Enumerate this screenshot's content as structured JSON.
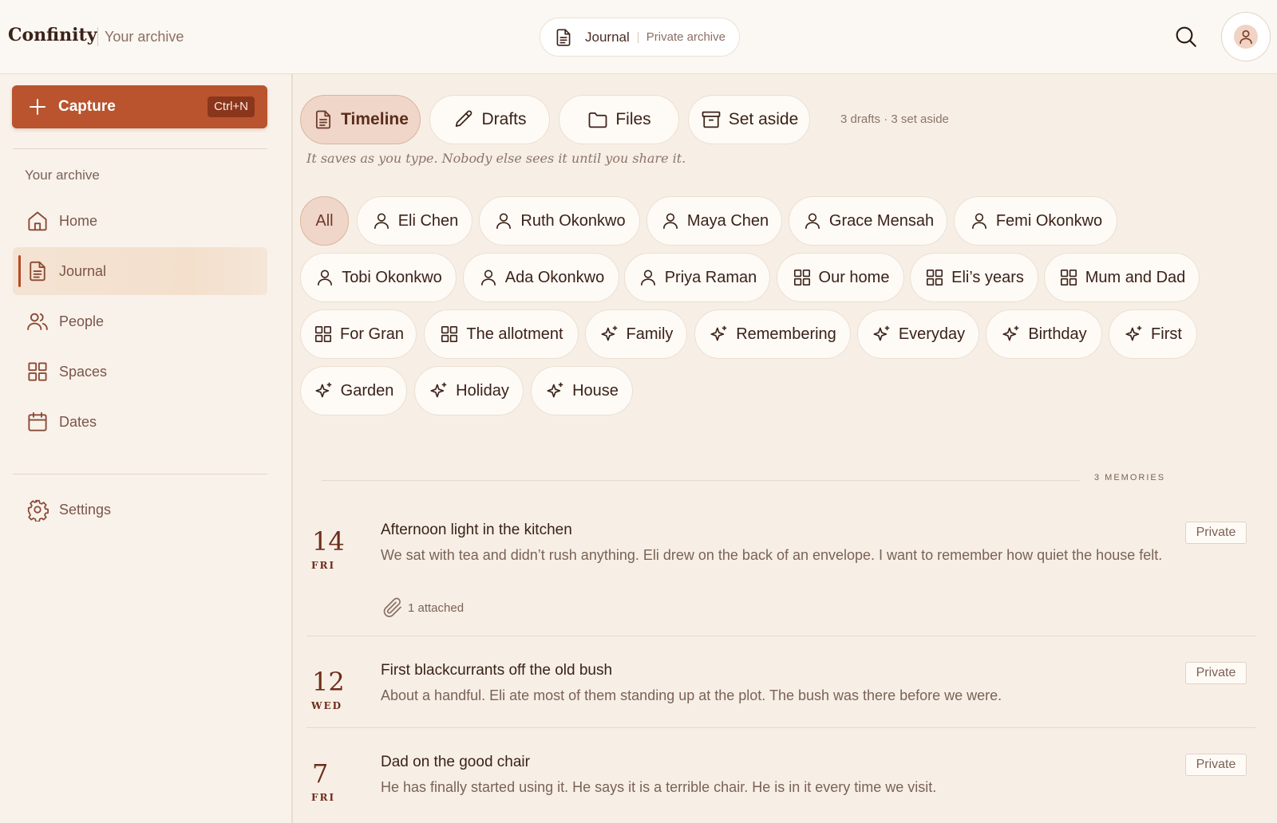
{
  "app": {
    "brand": "Confinity",
    "brand_sub": "Your archive"
  },
  "header": {
    "section_title": "Journal",
    "section_sub": "Private archive"
  },
  "sidebar": {
    "capture_label": "Capture",
    "capture_shortcut": "Ctrl+N",
    "section_label": "Your archive",
    "items": [
      {
        "label": "Home",
        "icon": "home-icon"
      },
      {
        "label": "Journal",
        "icon": "document-icon",
        "active": true
      },
      {
        "label": "People",
        "icon": "people-icon"
      },
      {
        "label": "Spaces",
        "icon": "grid-icon"
      },
      {
        "label": "Dates",
        "icon": "calendar-icon"
      }
    ],
    "settings_label": "Settings"
  },
  "tabs": [
    {
      "label": "Timeline",
      "icon": "document-icon",
      "active": true
    },
    {
      "label": "Drafts",
      "icon": "pencil-icon"
    },
    {
      "label": "Files",
      "icon": "folder-icon"
    },
    {
      "label": "Set aside",
      "icon": "archive-box-icon"
    }
  ],
  "counts_text": "3 drafts · 3 set aside",
  "tagline": "It saves as you type. Nobody else sees it until you share it.",
  "filters": [
    {
      "label": "All",
      "icon": "",
      "active": true
    },
    {
      "label": "Eli Chen",
      "icon": "person-icon"
    },
    {
      "label": "Ruth Okonkwo",
      "icon": "person-icon"
    },
    {
      "label": "Maya Chen",
      "icon": "person-icon"
    },
    {
      "label": "Grace Mensah",
      "icon": "person-icon"
    },
    {
      "label": "Femi Okonkwo",
      "icon": "person-icon"
    },
    {
      "label": "Tobi Okonkwo",
      "icon": "person-icon"
    },
    {
      "label": "Ada Okonkwo",
      "icon": "person-icon"
    },
    {
      "label": "Priya Raman",
      "icon": "person-icon"
    },
    {
      "label": "Our home",
      "icon": "grid-icon"
    },
    {
      "label": "Eli’s years",
      "icon": "grid-icon"
    },
    {
      "label": "Mum and Dad",
      "icon": "grid-icon"
    },
    {
      "label": "For Gran",
      "icon": "grid-icon"
    },
    {
      "label": "The allotment",
      "icon": "grid-icon"
    },
    {
      "label": "Family",
      "icon": "sparkle-icon"
    },
    {
      "label": "Remembering",
      "icon": "sparkle-icon"
    },
    {
      "label": "Everyday",
      "icon": "sparkle-icon"
    },
    {
      "label": "Birthday",
      "icon": "sparkle-icon"
    },
    {
      "label": "First",
      "icon": "sparkle-icon"
    },
    {
      "label": "Garden",
      "icon": "sparkle-icon"
    },
    {
      "label": "Holiday",
      "icon": "sparkle-icon"
    },
    {
      "label": "House",
      "icon": "sparkle-icon"
    }
  ],
  "memories_count": "3 MEMORIES",
  "entries": [
    {
      "day": "14",
      "dow": "FRI",
      "title": "Afternoon light in the kitchen",
      "body": "We sat with tea and didn’t rush anything. Eli drew on the back of an envelope. I want to remember how quiet the house felt.",
      "attachment": "1 attached",
      "badge": "Private"
    },
    {
      "day": "12",
      "dow": "WED",
      "title": "First blackcurrants off the old bush",
      "body": "About a handful. Eli ate most of them standing up at the plot. The bush was there before we were.",
      "badge": "Private"
    },
    {
      "day": "7",
      "dow": "FRI",
      "title": "Dad on the good chair",
      "body": "He has finally started using it. He says it is a terrible chair. He is in it every time we visit.",
      "badge": "Private"
    }
  ],
  "colors": {
    "accent": "#b9542e",
    "accent_dark": "#6e2d1a",
    "background": "#f7efe6",
    "active_chip": "#f0d6c8"
  }
}
